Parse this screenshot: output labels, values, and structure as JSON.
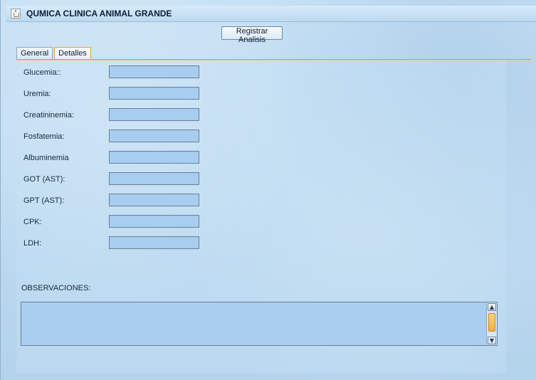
{
  "window": {
    "title": "QUMICA CLINICA ANIMAL GRANDE"
  },
  "toolbar": {
    "register_label": "Registrar Analisis"
  },
  "tabs": [
    {
      "label": "General",
      "active": false
    },
    {
      "label": "Detalles",
      "active": true
    }
  ],
  "fields": [
    {
      "label": "Glucemia::",
      "value": ""
    },
    {
      "label": "Uremia:",
      "value": ""
    },
    {
      "label": "Creatininemia:",
      "value": ""
    },
    {
      "label": "Fosfatemia:",
      "value": ""
    },
    {
      "label": "Albuminemia",
      "value": ""
    },
    {
      "label": "GOT (AST):",
      "value": ""
    },
    {
      "label": "GPT (AST):",
      "value": ""
    },
    {
      "label": "CPK:",
      "value": ""
    },
    {
      "label": "LDH:",
      "value": ""
    }
  ],
  "observaciones": {
    "label": "OBSERVACIONES:",
    "value": ""
  },
  "colors": {
    "accent": "#e0a030",
    "field_bg": "#a7cdf0",
    "background": "#b9d6ee"
  },
  "icons": {
    "app": "java-cup-icon",
    "scroll_up": "chevron-up-icon",
    "scroll_down": "chevron-down-icon"
  }
}
